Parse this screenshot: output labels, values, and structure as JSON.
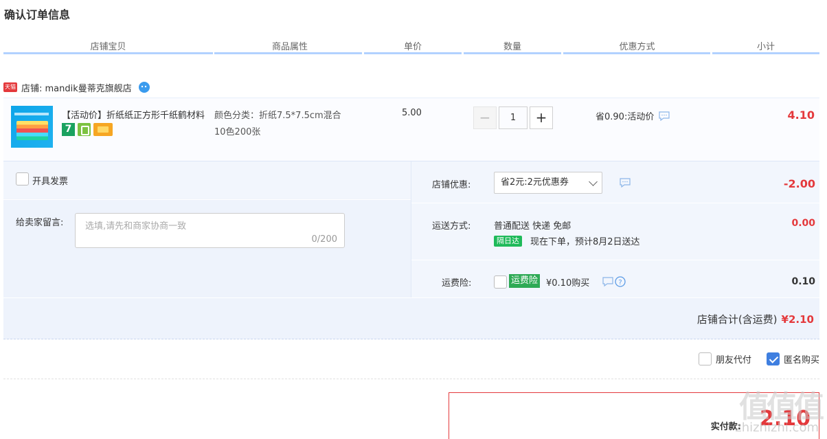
{
  "page": {
    "title": "确认订单信息"
  },
  "columns": [
    "店铺宝贝",
    "商品属性",
    "单价",
    "数量",
    "优惠方式",
    "小计"
  ],
  "shop": {
    "badge": "天猫",
    "label": "店铺: mandik曼蒂克旗舰店"
  },
  "item": {
    "title": "【活动价】折纸纸正方形千纸鹤材料",
    "badge_7": "7",
    "attr_line1": "颜色分类：折纸7.5*7.5cm混合",
    "attr_line2": "10色200张",
    "price": "5.00",
    "quantity": "1",
    "minus": "−",
    "plus": "+",
    "promo": "省0.90:活动价",
    "subtotal": "4.10"
  },
  "invoice": {
    "label": "开具发票"
  },
  "remark": {
    "label": "给卖家留言:",
    "placeholder": "选填,请先和商家协商一致",
    "counter": "0/200"
  },
  "discount": {
    "label": "店铺优惠:",
    "selected": "省2元:2元优惠券",
    "amount": "-2.00"
  },
  "shipping": {
    "label": "运送方式:",
    "method": "普通配送 快递 免邮",
    "tag": "隔日达",
    "eta": "现在下单，预计8月2日送达",
    "amount": "0.00"
  },
  "insurance": {
    "label": "运费险:",
    "tag": "运费险",
    "price": "¥0.10购买",
    "amount": "0.10"
  },
  "shop_total": {
    "label": "店铺合计(含运费)",
    "amount": "¥2.10"
  },
  "options": {
    "friend_pay": "朋友代付",
    "anonymous": "匿名购买"
  },
  "payment": {
    "label": "实付款:",
    "amount": "2.10"
  },
  "watermark": {
    "text": "值值值",
    "site": "zhizhizhi.com"
  }
}
